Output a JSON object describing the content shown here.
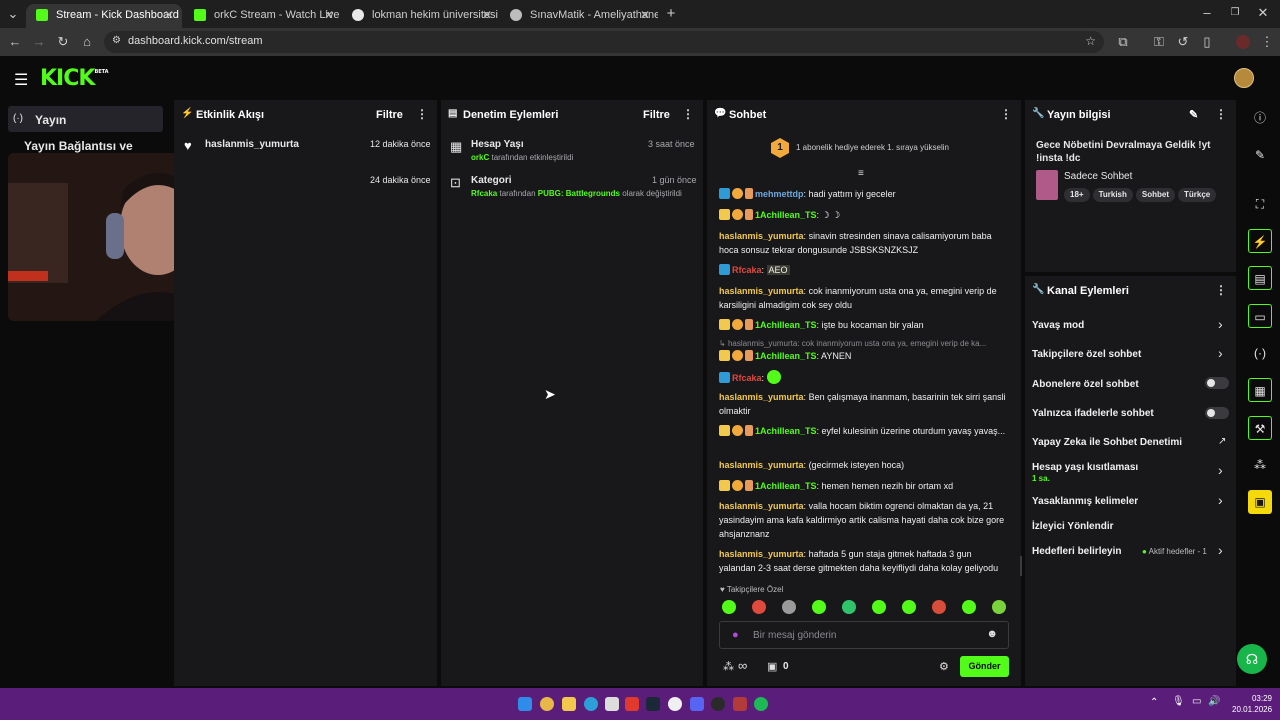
{
  "browser": {
    "tabs": [
      {
        "label": "Stream - Kick Dashboard",
        "active": true
      },
      {
        "label": "orkC Stream - Watch Live on Ki",
        "active": false
      },
      {
        "label": "lokman hekim üniversitesi - Go",
        "active": false
      },
      {
        "label": "SınavMatik - Ameliyathane ve Y",
        "active": false
      }
    ],
    "url": "dashboard.kick.com/stream"
  },
  "kick": {
    "logo": "KICK",
    "logo_beta": "BETA"
  },
  "sidebar": {
    "active_item": "Yayın",
    "item2": "Yayın Bağlantısı ve Anahtarı"
  },
  "activity": {
    "title": "Etkinlik Akışı",
    "filter": "Filtre",
    "items": [
      {
        "user": "haslanmis_yumurta",
        "time": "12 dakika önce"
      },
      {
        "user": "",
        "time": "24 dakika önce"
      }
    ]
  },
  "moderation": {
    "title": "Denetim Eylemleri",
    "filter": "Filtre",
    "items": [
      {
        "title": "Hesap Yaşı",
        "time": "3 saat önce",
        "user": "orkC",
        "rest": "tarafından etkinleştirildi"
      },
      {
        "title": "Kategori",
        "time": "1 gün önce",
        "user": "Rfcaka",
        "rest": "tarafından",
        "cat": "PUBG: Battlegrounds",
        "rest2": "olarak değiştirildi"
      }
    ]
  },
  "chat": {
    "title": "Sohbet",
    "gift_badge": "1",
    "gift_text": "1 abonelik hediye ederek 1. sıraya yükselin",
    "messages": [
      {
        "user": "mehmettdp",
        "text": "hadi yattım iyi geceler"
      },
      {
        "user": "1Achillean_TS",
        "text": "☽ ☽"
      },
      {
        "user": "haslanmis_yumurta",
        "text": "sinavin stresinden sinava calisamiyorum baba hoca sonsuz tekrar dongusunde JSBSKSNZKSJZ"
      },
      {
        "user": "Rfcaka",
        "text": "AEO"
      },
      {
        "user": "haslanmis_yumurta",
        "text": "cok inanmiyorum usta ona ya, emegini verip de karsiligini almadigim cok sey oldu"
      },
      {
        "user": "1Achillean_TS",
        "text": "işte bu kocaman bir yalan"
      },
      {
        "reply": "haslanmis_yumurta: cok inanmiyorum usta ona ya, emegini verip de ka..."
      },
      {
        "user": "1Achillean_TS",
        "text": "AYNEN"
      },
      {
        "user": "Rfcaka",
        "text": ""
      },
      {
        "user": "haslanmis_yumurta",
        "text": "Ben çalışmaya inanmam, basarinin tek sirri şansli olmaktir"
      },
      {
        "user": "1Achillean_TS",
        "text": "eyfel kulesinin üzerine oturdum yavaş yavaş..."
      },
      {
        "user": "haslanmis_yumurta",
        "text": "(gecirmek isteyen hoca)"
      },
      {
        "user": "1Achillean_TS",
        "text": "hemen hemen nezih bir ortam xd"
      },
      {
        "user": "haslanmis_yumurta",
        "text": "valla hocam biktim ogrenci olmaktan da ya, 21 yasindayim ama kafa kaldirmiyo artik calisma hayati daha cok bize gore ahsjanznanz"
      },
      {
        "user": "haslanmis_yumurta",
        "text": "haftada 5 gun staja gitmek haftada 3 gun yalandan 2-3 saat derse gitmekten daha keyifliydi daha kolay geliyodu"
      }
    ],
    "followers_only": "Takipçilere Özel",
    "input_placeholder": "Bir mesaj gönderin",
    "infinity": "∞",
    "count": "0",
    "send": "Gönder"
  },
  "stream_info": {
    "title": "Yayın bilgisi",
    "stream_title": "Gece Nöbetini Devralmaya Geldik !yt !insta !dc",
    "category": "Sadece Sohbet",
    "tags": [
      "18+",
      "Turkish",
      "Sohbet",
      "Türkçe"
    ]
  },
  "channel_actions": {
    "title": "Kanal Eylemleri",
    "slow": "Yavaş mod",
    "followers": "Takipçilere özel sohbet",
    "subs": "Abonelere özel sohbet",
    "emotes": "Yalnızca ifadelerle sohbet",
    "ai": "Yapay Zeka ile Sohbet Denetimi",
    "age": "Hesap yaşı kısıtlaması",
    "age_value": "1 sa.",
    "banned": "Yasaklanmış kelimeler",
    "redirect": "İzleyici Yönlendir",
    "goals": "Hedefleri belirleyin",
    "goals_status": "Aktif hedefler - 1"
  },
  "taskbar": {
    "time": "03:29",
    "date": "20.01.2026"
  },
  "colors": {
    "accent": "#53fc18",
    "panel": "#18181b",
    "taskbar": "#5a1d7a"
  }
}
